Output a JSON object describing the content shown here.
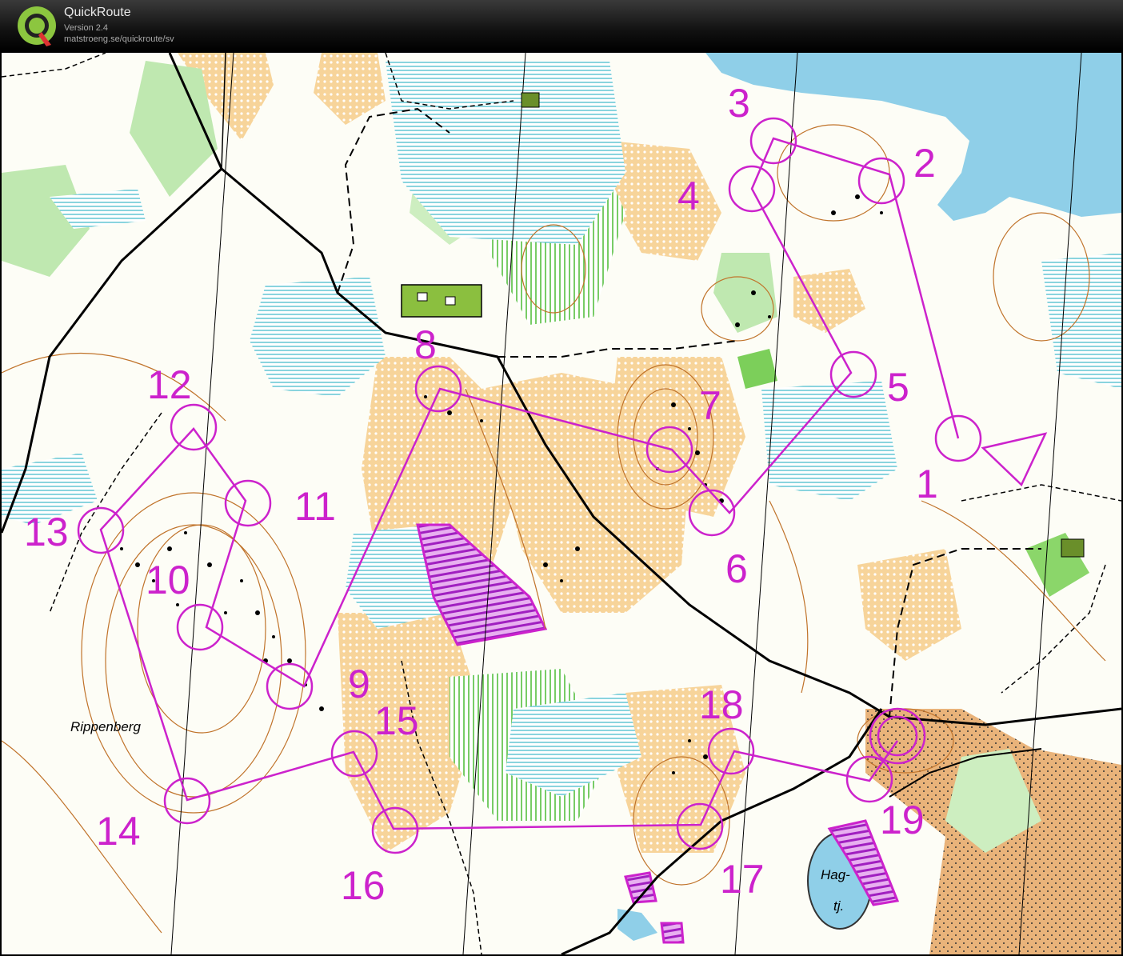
{
  "app": {
    "title": "QuickRoute",
    "version": "Version 2.4",
    "url": "matstroeng.se/quickroute/sv"
  },
  "map": {
    "course_color": "#cc22cc",
    "water_color": "#8fcfe8",
    "open_land_color": "#f6c67a",
    "vegetation_color": "#7ccf5a",
    "place_names": [
      "Rippenberg",
      "Hag-",
      "tj."
    ],
    "controls": [
      {
        "label": "1"
      },
      {
        "label": "2"
      },
      {
        "label": "3"
      },
      {
        "label": "4"
      },
      {
        "label": "5"
      },
      {
        "label": "6"
      },
      {
        "label": "7"
      },
      {
        "label": "8"
      },
      {
        "label": "9"
      },
      {
        "label": "10"
      },
      {
        "label": "11"
      },
      {
        "label": "12"
      },
      {
        "label": "13"
      },
      {
        "label": "14"
      },
      {
        "label": "15"
      },
      {
        "label": "16"
      },
      {
        "label": "17"
      },
      {
        "label": "18"
      },
      {
        "label": "19"
      }
    ]
  }
}
